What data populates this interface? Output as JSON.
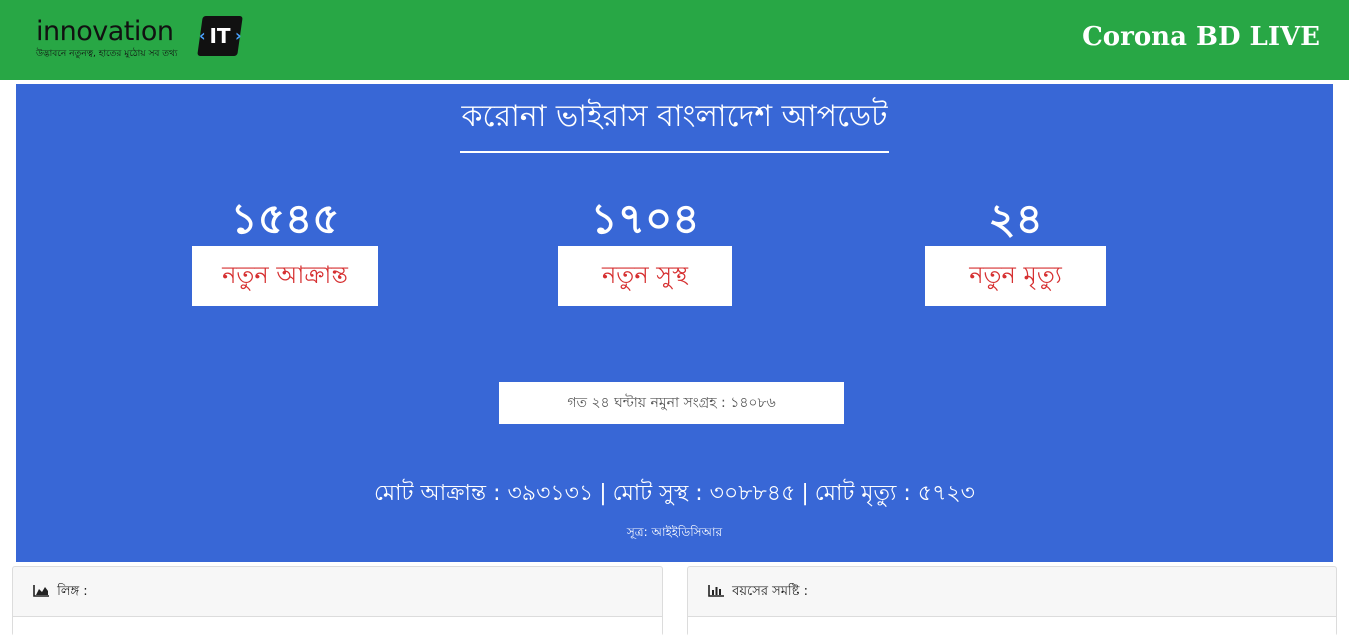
{
  "header": {
    "logo_text": "innovation",
    "logo_badge": "IT",
    "logo_tagline": "উদ্ভাবনে নতুনত্ব, হাতের মুঠোয় সব তথ্য",
    "brand": "Corona BD LIVE",
    "colors": {
      "bar": "#28a745"
    }
  },
  "panel": {
    "title": "করোনা ভাইরাস বাংলাদেশ আপডেট",
    "stats": [
      {
        "value": "১৫৪৫",
        "label": "নতুন আক্রান্ত"
      },
      {
        "value": "১৭০৪",
        "label": "নতুন সুস্থ"
      },
      {
        "value": "২৪",
        "label": "নতুন মৃত্যু"
      }
    ],
    "sample_text": "গত ২৪ ঘন্টায় নমুনা সংগ্রহ : ১৪০৮৬",
    "totals": {
      "infected": "মোট আক্রান্ত : ৩৯৩১৩১",
      "recovered": "মোট সুস্থ : ৩০৮৮৪৫",
      "deaths": "মোট মৃত্যু : ৫৭২৩",
      "separator": "|"
    },
    "source": "সূত্র: আইইডিসিআর",
    "colors": {
      "background": "#3867d6",
      "label_text": "#d63031"
    }
  },
  "cards": {
    "gender_title": "লিঙ্গ :",
    "age_title": "বয়সের সমষ্টি :",
    "gender_icon": "area-chart-icon",
    "age_icon": "bar-chart-icon"
  }
}
